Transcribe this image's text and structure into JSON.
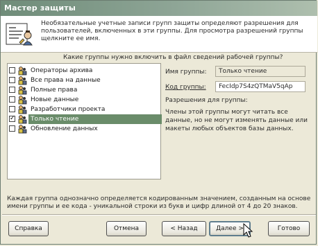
{
  "window": {
    "title": "Мастер защиты"
  },
  "header": {
    "description": "Необязательные учетные записи групп защиты определяют разрешения для пользователей, включенных в эти группы. Для просмотра разрешений группы щелкните ее имя.",
    "icon": "wizard-person-document-icon"
  },
  "question": "Какие группы нужно включить в файл сведений рабочей группы?",
  "groups": [
    {
      "label": "Операторы архива",
      "checked": false,
      "selected": false
    },
    {
      "label": "Все права на данные",
      "checked": false,
      "selected": false
    },
    {
      "label": "Полные права",
      "checked": false,
      "selected": false
    },
    {
      "label": "Новые данные",
      "checked": false,
      "selected": false
    },
    {
      "label": "Разработчики проекта",
      "checked": false,
      "selected": false
    },
    {
      "label": "Только чтение",
      "checked": true,
      "selected": true
    },
    {
      "label": "Обновление данных",
      "checked": false,
      "selected": false
    }
  ],
  "details": {
    "group_name_label": "Имя группы:",
    "group_name_value": "Только чтение",
    "group_code_label": "Код группы:",
    "group_code_value": "FecIdp7S4zQTMaV5qAp",
    "permissions_label": "Разрешения для группы:",
    "permissions_text": "Члены этой группы могут читать все данные, но не могут изменять данные или макеты любых объектов базы данных."
  },
  "bottom_note": "Каждая группа однозначно определяется кодированным значением, созданным на основе имени группы и ее кода - уникальной строки из букв и цифр длиной от 4 до 20 знаков.",
  "buttons": {
    "help": "Справка",
    "cancel": "Отмена",
    "back": "< Назад",
    "next": "Далее >",
    "finish": "Готово"
  },
  "colors": {
    "titlebar": "#6f8c79",
    "selection": "#6a8c6a",
    "window_bg": "#ece9d8"
  }
}
